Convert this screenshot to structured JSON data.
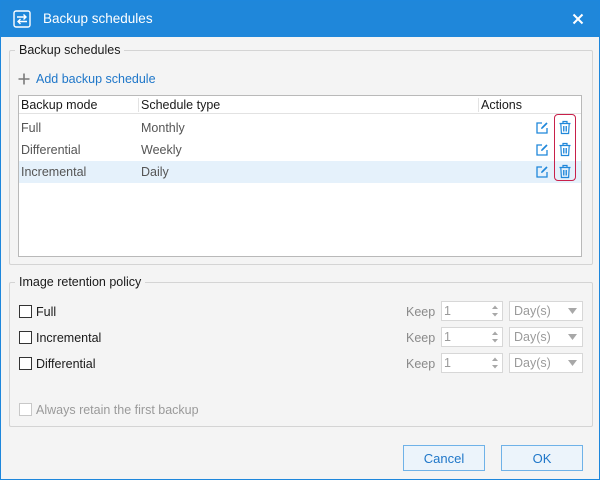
{
  "window": {
    "title": "Backup schedules"
  },
  "schedules_group": {
    "legend": "Backup schedules",
    "add_label": "Add backup schedule",
    "columns": [
      "Backup mode",
      "Schedule type",
      "Actions"
    ],
    "rows": [
      {
        "mode": "Full",
        "schedule": "Monthly",
        "selected": false
      },
      {
        "mode": "Differential",
        "schedule": "Weekly",
        "selected": false
      },
      {
        "mode": "Incremental",
        "schedule": "Daily",
        "selected": true
      }
    ]
  },
  "retention_group": {
    "legend": "Image retention policy",
    "items": [
      {
        "label": "Full",
        "keep_label": "Keep",
        "value": "1",
        "unit": "Day(s)"
      },
      {
        "label": "Incremental",
        "keep_label": "Keep",
        "value": "1",
        "unit": "Day(s)"
      },
      {
        "label": "Differential",
        "keep_label": "Keep",
        "value": "1",
        "unit": "Day(s)"
      }
    ],
    "always_retain_label": "Always retain the first backup"
  },
  "buttons": {
    "cancel": "Cancel",
    "ok": "OK"
  },
  "colors": {
    "accent": "#1f87da",
    "link": "#1f77c9",
    "highlight": "#c8204a",
    "selected_row": "#e5f1fb"
  },
  "icons": [
    "swap-arrows-icon",
    "close-icon",
    "plus-icon",
    "edit-icon",
    "trash-icon",
    "spinner-arrows-icon",
    "chevron-down-icon"
  ]
}
